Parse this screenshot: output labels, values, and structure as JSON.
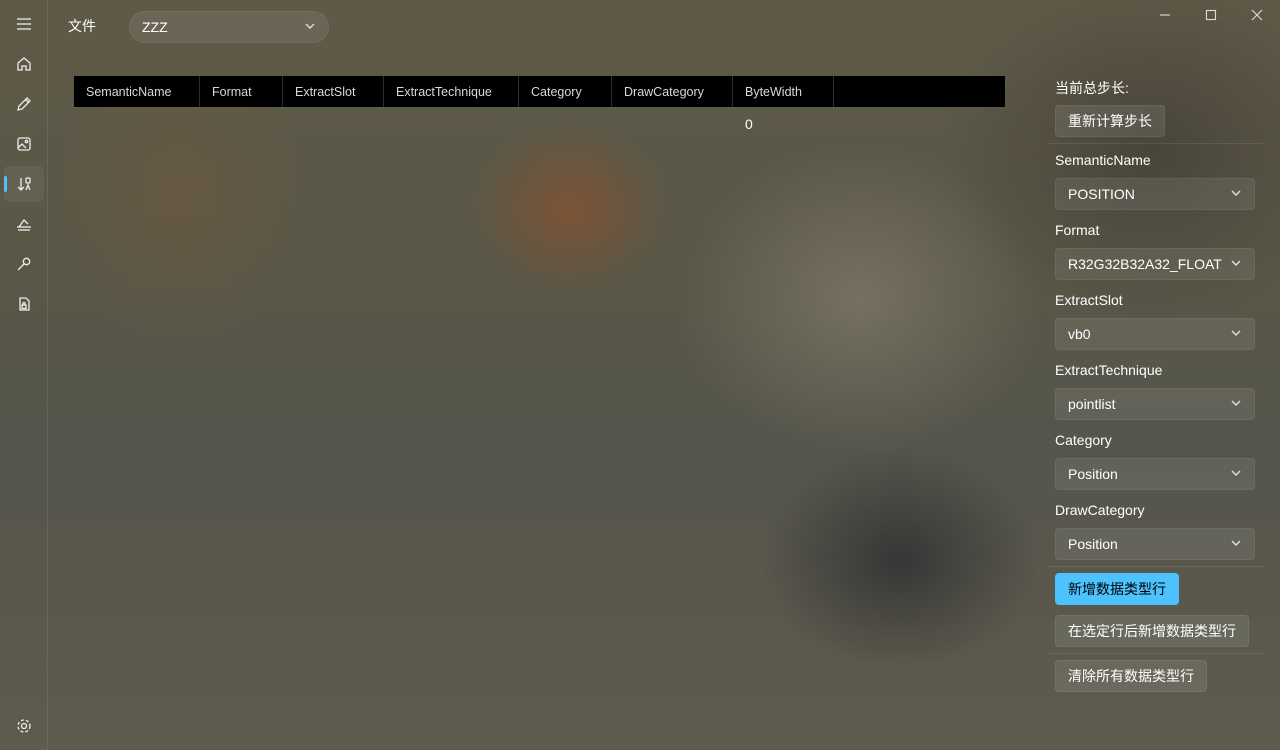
{
  "nav": {
    "items": [
      {
        "icon": "hamburger-menu-icon"
      },
      {
        "icon": "home-icon"
      },
      {
        "icon": "pencil-icon"
      },
      {
        "icon": "image-icon"
      },
      {
        "icon": "sort-icon",
        "active": true
      },
      {
        "icon": "layers-icon"
      },
      {
        "icon": "wrench-icon"
      },
      {
        "icon": "file-lock-icon"
      },
      {
        "icon": "settings-gear-icon"
      }
    ],
    "accent_color": "#4cc2ff"
  },
  "topbar": {
    "file_menu_label": "文件",
    "file_combo_value": "ZZZ"
  },
  "window_controls": [
    "minimize",
    "maximize",
    "close"
  ],
  "table": {
    "columns": [
      "SemanticName",
      "Format",
      "ExtractSlot",
      "ExtractTechnique",
      "Category",
      "DrawCategory",
      "ByteWidth"
    ],
    "rows": [],
    "bytewidth_cell": "0"
  },
  "panel": {
    "total_stride_label": "当前总步长:",
    "recalc_button": "重新计算步长",
    "fields": [
      {
        "label": "SemanticName",
        "value": "POSITION"
      },
      {
        "label": "Format",
        "value": "R32G32B32A32_FLOAT"
      },
      {
        "label": "ExtractSlot",
        "value": "vb0"
      },
      {
        "label": "ExtractTechnique",
        "value": "pointlist"
      },
      {
        "label": "Category",
        "value": "Position"
      },
      {
        "label": "DrawCategory",
        "value": "Position"
      }
    ],
    "add_row_button": "新增数据类型行",
    "insert_after_button": "在选定行后新增数据类型行",
    "clear_all_button": "清除所有数据类型行"
  }
}
